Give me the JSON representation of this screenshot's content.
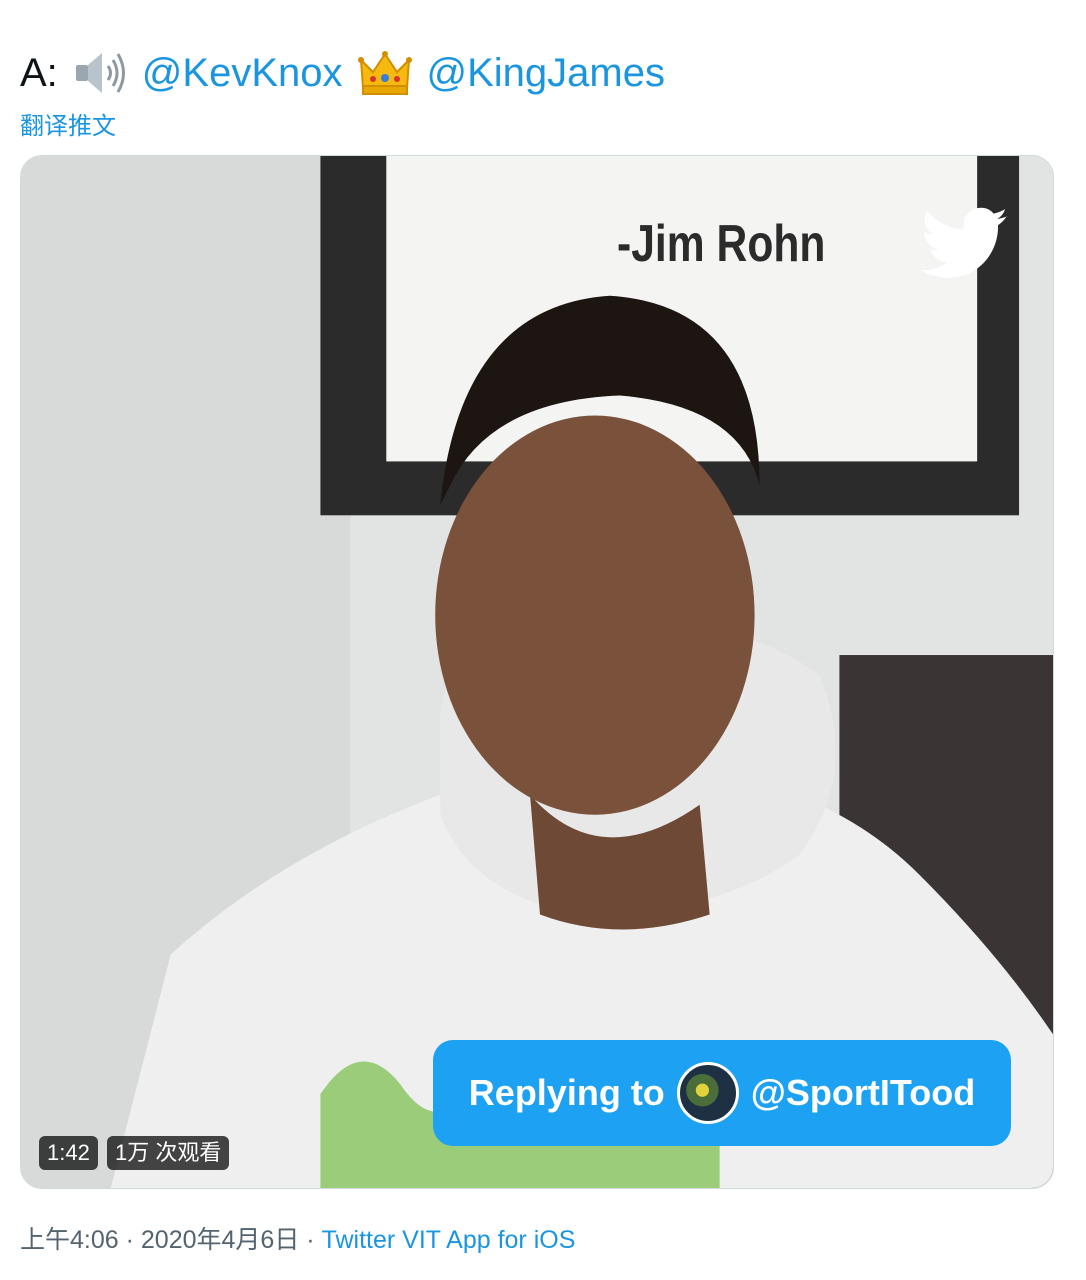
{
  "tweet": {
    "prefix": "A:",
    "mentions": [
      "@KevKnox",
      "@KingJames"
    ],
    "emojis": [
      "speaker-high-volume",
      "crown"
    ],
    "translate_label": "翻译推文"
  },
  "video": {
    "poster_quote_attribution": "-Jim Rohn",
    "watermark": "twitter-bird",
    "reply_overlay": {
      "prefix": "Replying to",
      "handle": "@SportITood"
    },
    "duration": "1:42",
    "views": "1万 次观看"
  },
  "meta": {
    "time": "上午4:06",
    "separator": "·",
    "date": "2020年4月6日",
    "source": "Twitter VIT App for iOS"
  },
  "colors": {
    "link": "#1b95e0",
    "reply_pill": "#1da1f2",
    "text": "#0f1419",
    "meta": "#536471"
  }
}
